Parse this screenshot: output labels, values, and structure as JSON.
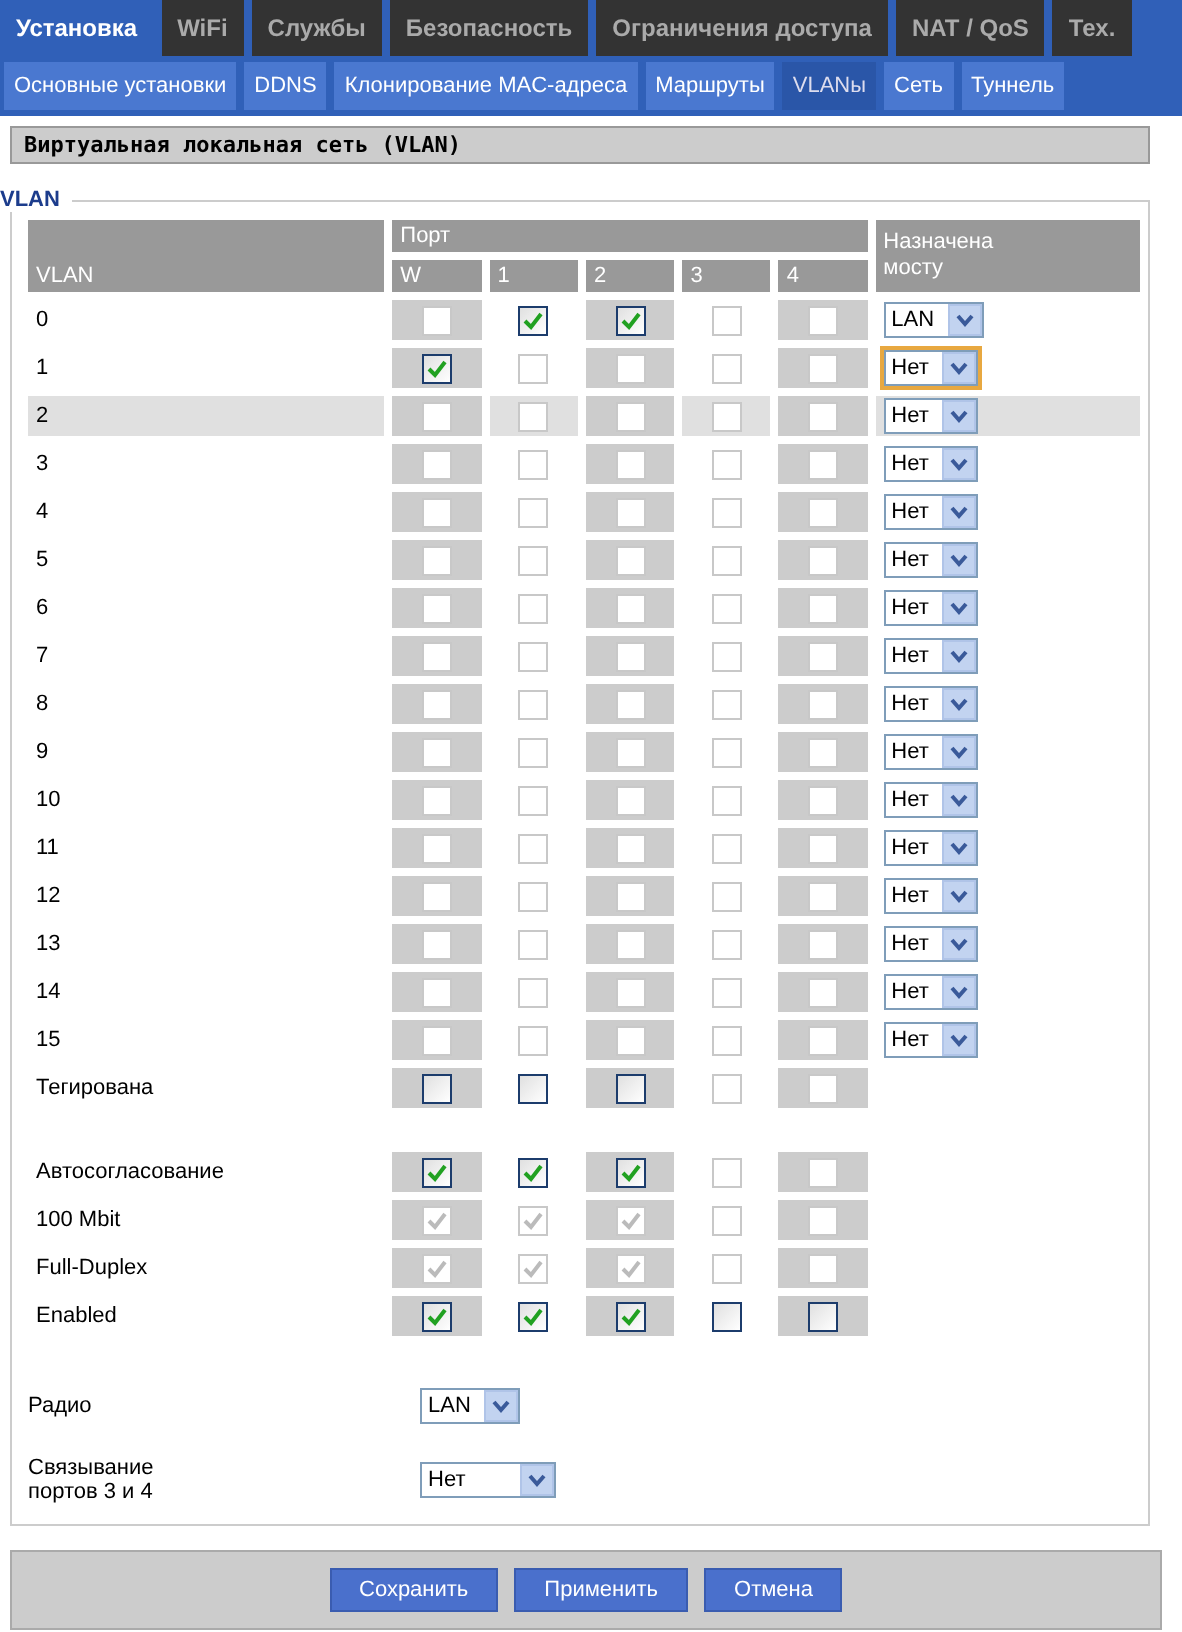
{
  "top_tabs": [
    {
      "label": "Установка",
      "selected": true
    },
    {
      "label": "WiFi",
      "selected": false
    },
    {
      "label": "Службы",
      "selected": false
    },
    {
      "label": "Безопасность",
      "selected": false
    },
    {
      "label": "Ограничения доступа",
      "selected": false
    },
    {
      "label": "NAT / QoS",
      "selected": false
    },
    {
      "label": "Тех.",
      "selected": false
    }
  ],
  "sub_tabs": [
    {
      "label": "Основные установки",
      "selected": false
    },
    {
      "label": "DDNS",
      "selected": false
    },
    {
      "label": "Клонирование MAC-адреса",
      "selected": false
    },
    {
      "label": "Маршруты",
      "selected": false
    },
    {
      "label": "VLANы",
      "selected": true
    },
    {
      "label": "Сеть",
      "selected": false
    },
    {
      "label": "Туннель",
      "selected": false
    }
  ],
  "section_title": "Виртуальная локальная сеть (VLAN)",
  "legend": "VLAN",
  "table": {
    "vlan_header": "VLAN",
    "port_header": "Порт",
    "ports": [
      "W",
      "1",
      "2",
      "3",
      "4"
    ],
    "bridge_header": "Назначена мосту",
    "rows": [
      {
        "vlan": "0",
        "highlighted": false,
        "ports": [
          {
            "checked": false,
            "disabled": true
          },
          {
            "checked": true,
            "disabled": false
          },
          {
            "checked": true,
            "disabled": false
          },
          {
            "checked": false,
            "disabled": true
          },
          {
            "checked": false,
            "disabled": true
          }
        ],
        "bridge": {
          "value": "LAN",
          "focused": false
        }
      },
      {
        "vlan": "1",
        "highlighted": false,
        "ports": [
          {
            "checked": true,
            "disabled": false
          },
          {
            "checked": false,
            "disabled": true
          },
          {
            "checked": false,
            "disabled": true
          },
          {
            "checked": false,
            "disabled": true
          },
          {
            "checked": false,
            "disabled": true
          }
        ],
        "bridge": {
          "value": "Нет",
          "focused": true
        }
      },
      {
        "vlan": "2",
        "highlighted": true,
        "ports": [
          {
            "checked": false,
            "disabled": true
          },
          {
            "checked": false,
            "disabled": true
          },
          {
            "checked": false,
            "disabled": true
          },
          {
            "checked": false,
            "disabled": true
          },
          {
            "checked": false,
            "disabled": true
          }
        ],
        "bridge": {
          "value": "Нет",
          "focused": false
        }
      },
      {
        "vlan": "3",
        "highlighted": false,
        "ports": [
          {
            "checked": false,
            "disabled": true
          },
          {
            "checked": false,
            "disabled": true
          },
          {
            "checked": false,
            "disabled": true
          },
          {
            "checked": false,
            "disabled": true
          },
          {
            "checked": false,
            "disabled": true
          }
        ],
        "bridge": {
          "value": "Нет",
          "focused": false
        }
      },
      {
        "vlan": "4",
        "highlighted": false,
        "ports": [
          {
            "checked": false,
            "disabled": true
          },
          {
            "checked": false,
            "disabled": true
          },
          {
            "checked": false,
            "disabled": true
          },
          {
            "checked": false,
            "disabled": true
          },
          {
            "checked": false,
            "disabled": true
          }
        ],
        "bridge": {
          "value": "Нет",
          "focused": false
        }
      },
      {
        "vlan": "5",
        "highlighted": false,
        "ports": [
          {
            "checked": false,
            "disabled": true
          },
          {
            "checked": false,
            "disabled": true
          },
          {
            "checked": false,
            "disabled": true
          },
          {
            "checked": false,
            "disabled": true
          },
          {
            "checked": false,
            "disabled": true
          }
        ],
        "bridge": {
          "value": "Нет",
          "focused": false
        }
      },
      {
        "vlan": "6",
        "highlighted": false,
        "ports": [
          {
            "checked": false,
            "disabled": true
          },
          {
            "checked": false,
            "disabled": true
          },
          {
            "checked": false,
            "disabled": true
          },
          {
            "checked": false,
            "disabled": true
          },
          {
            "checked": false,
            "disabled": true
          }
        ],
        "bridge": {
          "value": "Нет",
          "focused": false
        }
      },
      {
        "vlan": "7",
        "highlighted": false,
        "ports": [
          {
            "checked": false,
            "disabled": true
          },
          {
            "checked": false,
            "disabled": true
          },
          {
            "checked": false,
            "disabled": true
          },
          {
            "checked": false,
            "disabled": true
          },
          {
            "checked": false,
            "disabled": true
          }
        ],
        "bridge": {
          "value": "Нет",
          "focused": false
        }
      },
      {
        "vlan": "8",
        "highlighted": false,
        "ports": [
          {
            "checked": false,
            "disabled": true
          },
          {
            "checked": false,
            "disabled": true
          },
          {
            "checked": false,
            "disabled": true
          },
          {
            "checked": false,
            "disabled": true
          },
          {
            "checked": false,
            "disabled": true
          }
        ],
        "bridge": {
          "value": "Нет",
          "focused": false
        }
      },
      {
        "vlan": "9",
        "highlighted": false,
        "ports": [
          {
            "checked": false,
            "disabled": true
          },
          {
            "checked": false,
            "disabled": true
          },
          {
            "checked": false,
            "disabled": true
          },
          {
            "checked": false,
            "disabled": true
          },
          {
            "checked": false,
            "disabled": true
          }
        ],
        "bridge": {
          "value": "Нет",
          "focused": false
        }
      },
      {
        "vlan": "10",
        "highlighted": false,
        "ports": [
          {
            "checked": false,
            "disabled": true
          },
          {
            "checked": false,
            "disabled": true
          },
          {
            "checked": false,
            "disabled": true
          },
          {
            "checked": false,
            "disabled": true
          },
          {
            "checked": false,
            "disabled": true
          }
        ],
        "bridge": {
          "value": "Нет",
          "focused": false
        }
      },
      {
        "vlan": "11",
        "highlighted": false,
        "ports": [
          {
            "checked": false,
            "disabled": true
          },
          {
            "checked": false,
            "disabled": true
          },
          {
            "checked": false,
            "disabled": true
          },
          {
            "checked": false,
            "disabled": true
          },
          {
            "checked": false,
            "disabled": true
          }
        ],
        "bridge": {
          "value": "Нет",
          "focused": false
        }
      },
      {
        "vlan": "12",
        "highlighted": false,
        "ports": [
          {
            "checked": false,
            "disabled": true
          },
          {
            "checked": false,
            "disabled": true
          },
          {
            "checked": false,
            "disabled": true
          },
          {
            "checked": false,
            "disabled": true
          },
          {
            "checked": false,
            "disabled": true
          }
        ],
        "bridge": {
          "value": "Нет",
          "focused": false
        }
      },
      {
        "vlan": "13",
        "highlighted": false,
        "ports": [
          {
            "checked": false,
            "disabled": true
          },
          {
            "checked": false,
            "disabled": true
          },
          {
            "checked": false,
            "disabled": true
          },
          {
            "checked": false,
            "disabled": true
          },
          {
            "checked": false,
            "disabled": true
          }
        ],
        "bridge": {
          "value": "Нет",
          "focused": false
        }
      },
      {
        "vlan": "14",
        "highlighted": false,
        "ports": [
          {
            "checked": false,
            "disabled": true
          },
          {
            "checked": false,
            "disabled": true
          },
          {
            "checked": false,
            "disabled": true
          },
          {
            "checked": false,
            "disabled": true
          },
          {
            "checked": false,
            "disabled": true
          }
        ],
        "bridge": {
          "value": "Нет",
          "focused": false
        }
      },
      {
        "vlan": "15",
        "highlighted": false,
        "ports": [
          {
            "checked": false,
            "disabled": true
          },
          {
            "checked": false,
            "disabled": true
          },
          {
            "checked": false,
            "disabled": true
          },
          {
            "checked": false,
            "disabled": true
          },
          {
            "checked": false,
            "disabled": true
          }
        ],
        "bridge": {
          "value": "Нет",
          "focused": false
        }
      }
    ],
    "tagged": {
      "label": "Тегирована",
      "ports": [
        {
          "checked": false,
          "disabled": false
        },
        {
          "checked": false,
          "disabled": false
        },
        {
          "checked": false,
          "disabled": false
        },
        {
          "checked": false,
          "disabled": true
        },
        {
          "checked": false,
          "disabled": true
        }
      ]
    }
  },
  "port_settings": [
    {
      "label": "Автосогласование",
      "ports": [
        {
          "checked": true,
          "disabled": false
        },
        {
          "checked": true,
          "disabled": false
        },
        {
          "checked": true,
          "disabled": false
        },
        {
          "checked": false,
          "disabled": true
        },
        {
          "checked": false,
          "disabled": true
        }
      ]
    },
    {
      "label": "100 Mbit",
      "ports": [
        {
          "checked": true,
          "disabled": true
        },
        {
          "checked": true,
          "disabled": true
        },
        {
          "checked": true,
          "disabled": true
        },
        {
          "checked": false,
          "disabled": true
        },
        {
          "checked": false,
          "disabled": true
        }
      ]
    },
    {
      "label": "Full-Duplex",
      "ports": [
        {
          "checked": true,
          "disabled": true
        },
        {
          "checked": true,
          "disabled": true
        },
        {
          "checked": true,
          "disabled": true
        },
        {
          "checked": false,
          "disabled": true
        },
        {
          "checked": false,
          "disabled": true
        }
      ]
    },
    {
      "label": "Enabled",
      "ports": [
        {
          "checked": true,
          "disabled": false
        },
        {
          "checked": true,
          "disabled": false
        },
        {
          "checked": true,
          "disabled": false
        },
        {
          "checked": false,
          "disabled": false
        },
        {
          "checked": false,
          "disabled": false
        }
      ]
    }
  ],
  "radio": {
    "label": "Радио",
    "value": "LAN"
  },
  "bonding": {
    "label": "Связывание портов 3 и 4",
    "value": "Нет"
  },
  "buttons": [
    "Сохранить",
    "Применить",
    "Отмена"
  ]
}
